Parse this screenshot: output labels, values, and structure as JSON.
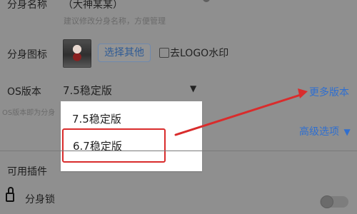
{
  "header": {
    "partial_title": "分身名称",
    "partial_value": "（大神某某）",
    "hint": "建议修改分身名称，方便管理"
  },
  "icon_row": {
    "label": "分身图标",
    "choose_label": "选择其他",
    "logo_watermark_label": "去LOGO水印"
  },
  "os_row": {
    "label": "OS版本",
    "selected_value": "7.5稳定版",
    "more_versions": "更多版本",
    "partial_hint": "OS版本即为分身"
  },
  "dropdown": {
    "options": [
      "7.5稳定版",
      "6.7稳定版"
    ]
  },
  "advanced": {
    "label": "高级选项",
    "icon": "▼"
  },
  "plugins": {
    "section_label": "可用插件",
    "lock_label": "分身锁"
  },
  "colors": {
    "accent": "#2f6fd0",
    "highlight": "#d92c2c"
  }
}
